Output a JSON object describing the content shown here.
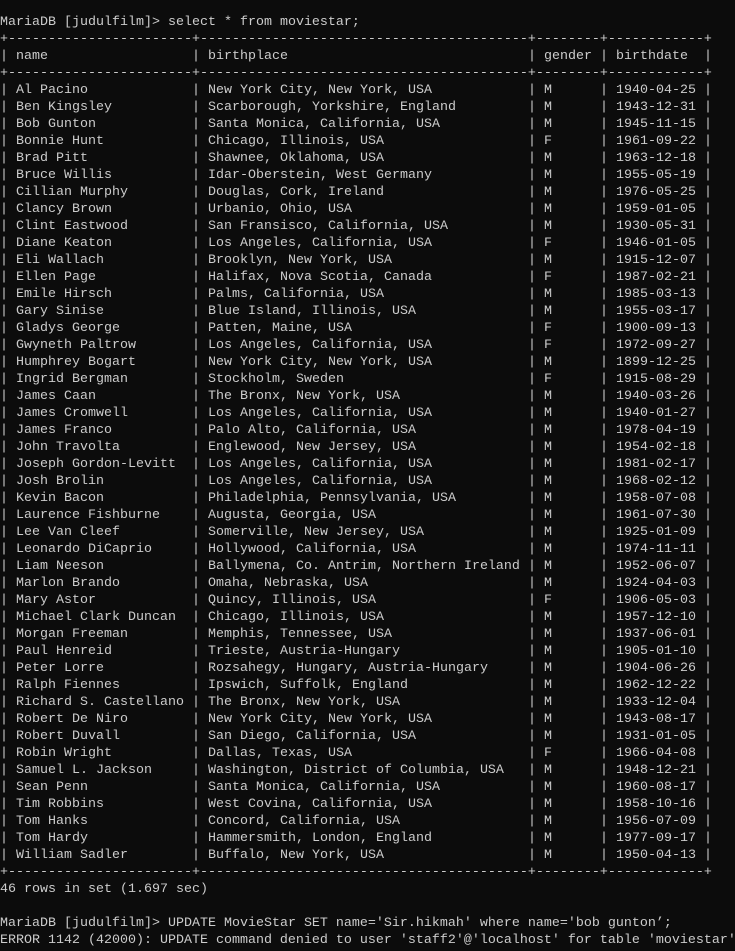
{
  "terminal": {
    "prompt": "MariaDB [judulfilm]> ",
    "command1": "select * from moviestar;",
    "columns": [
      "name",
      "birthplace",
      "gender",
      "birthdate"
    ],
    "rows": [
      [
        "Al Pacino",
        "New York City, New York, USA",
        "M",
        "1940-04-25"
      ],
      [
        "Ben Kingsley",
        "Scarborough, Yorkshire, England",
        "M",
        "1943-12-31"
      ],
      [
        "Bob Gunton",
        "Santa Monica, California, USA",
        "M",
        "1945-11-15"
      ],
      [
        "Bonnie Hunt",
        "Chicago, Illinois, USA",
        "F",
        "1961-09-22"
      ],
      [
        "Brad Pitt",
        "Shawnee, Oklahoma, USA",
        "M",
        "1963-12-18"
      ],
      [
        "Bruce Willis",
        "Idar-Oberstein, West Germany",
        "M",
        "1955-05-19"
      ],
      [
        "Cillian Murphy",
        "Douglas, Cork, Ireland",
        "M",
        "1976-05-25"
      ],
      [
        "Clancy Brown",
        "Urbanio, Ohio, USA",
        "M",
        "1959-01-05"
      ],
      [
        "Clint Eastwood",
        "San Fransisco, California, USA",
        "M",
        "1930-05-31"
      ],
      [
        "Diane Keaton",
        "Los Angeles, California, USA",
        "F",
        "1946-01-05"
      ],
      [
        "Eli Wallach",
        "Brooklyn, New York, USA",
        "M",
        "1915-12-07"
      ],
      [
        "Ellen Page",
        "Halifax, Nova Scotia, Canada",
        "F",
        "1987-02-21"
      ],
      [
        "Emile Hirsch",
        "Palms, California, USA",
        "M",
        "1985-03-13"
      ],
      [
        "Gary Sinise",
        "Blue Island, Illinois, USA",
        "M",
        "1955-03-17"
      ],
      [
        "Gladys George",
        "Patten, Maine, USA",
        "F",
        "1900-09-13"
      ],
      [
        "Gwyneth Paltrow",
        "Los Angeles, California, USA",
        "F",
        "1972-09-27"
      ],
      [
        "Humphrey Bogart",
        "New York City, New York, USA",
        "M",
        "1899-12-25"
      ],
      [
        "Ingrid Bergman",
        "Stockholm, Sweden",
        "F",
        "1915-08-29"
      ],
      [
        "James Caan",
        "The Bronx, New York, USA",
        "M",
        "1940-03-26"
      ],
      [
        "James Cromwell",
        "Los Angeles, California, USA",
        "M",
        "1940-01-27"
      ],
      [
        "James Franco",
        "Palo Alto, California, USA",
        "M",
        "1978-04-19"
      ],
      [
        "John Travolta",
        "Englewood, New Jersey, USA",
        "M",
        "1954-02-18"
      ],
      [
        "Joseph Gordon-Levitt",
        "Los Angeles, California, USA",
        "M",
        "1981-02-17"
      ],
      [
        "Josh Brolin",
        "Los Angeles, California, USA",
        "M",
        "1968-02-12"
      ],
      [
        "Kevin Bacon",
        "Philadelphia, Pennsylvania, USA",
        "M",
        "1958-07-08"
      ],
      [
        "Laurence Fishburne",
        "Augusta, Georgia, USA",
        "M",
        "1961-07-30"
      ],
      [
        "Lee Van Cleef",
        "Somerville, New Jersey, USA",
        "M",
        "1925-01-09"
      ],
      [
        "Leonardo DiCaprio",
        "Hollywood, California, USA",
        "M",
        "1974-11-11"
      ],
      [
        "Liam Neeson",
        "Ballymena, Co. Antrim, Northern Ireland",
        "M",
        "1952-06-07"
      ],
      [
        "Marlon Brando",
        "Omaha, Nebraska, USA",
        "M",
        "1924-04-03"
      ],
      [
        "Mary Astor",
        "Quincy, Illinois, USA",
        "F",
        "1906-05-03"
      ],
      [
        "Michael Clark Duncan",
        "Chicago, Illinois, USA",
        "M",
        "1957-12-10"
      ],
      [
        "Morgan Freeman",
        "Memphis, Tennessee, USA",
        "M",
        "1937-06-01"
      ],
      [
        "Paul Henreid",
        "Trieste, Austria-Hungary",
        "M",
        "1905-01-10"
      ],
      [
        "Peter Lorre",
        "Rozsahegy, Hungary, Austria-Hungary",
        "M",
        "1904-06-26"
      ],
      [
        "Ralph Fiennes",
        "Ipswich, Suffolk, England",
        "M",
        "1962-12-22"
      ],
      [
        "Richard S. Castellano",
        "The Bronx, New York, USA",
        "M",
        "1933-12-04"
      ],
      [
        "Robert De Niro",
        "New York City, New York, USA",
        "M",
        "1943-08-17"
      ],
      [
        "Robert Duvall",
        "San Diego, California, USA",
        "M",
        "1931-01-05"
      ],
      [
        "Robin Wright",
        "Dallas, Texas, USA",
        "F",
        "1966-04-08"
      ],
      [
        "Samuel L. Jackson",
        "Washington, District of Columbia, USA",
        "M",
        "1948-12-21"
      ],
      [
        "Sean Penn",
        "Santa Monica, California, USA",
        "M",
        "1960-08-17"
      ],
      [
        "Tim Robbins",
        "West Covina, California, USA",
        "M",
        "1958-10-16"
      ],
      [
        "Tom Hanks",
        "Concord, California, USA",
        "M",
        "1956-07-09"
      ],
      [
        "Tom Hardy",
        "Hammersmith, London, England",
        "M",
        "1977-09-17"
      ],
      [
        "William Sadler",
        "Buffalo, New York, USA",
        "M",
        "1950-04-13"
      ]
    ],
    "result_summary": "46 rows in set (1.697 sec)",
    "command2": "UPDATE MovieStar SET name='Sir.hikmah' where name='bob gunton’;",
    "error": "ERROR 1142 (42000): UPDATE command denied to user 'staff2'@'localhost' for table 'moviestar'"
  }
}
